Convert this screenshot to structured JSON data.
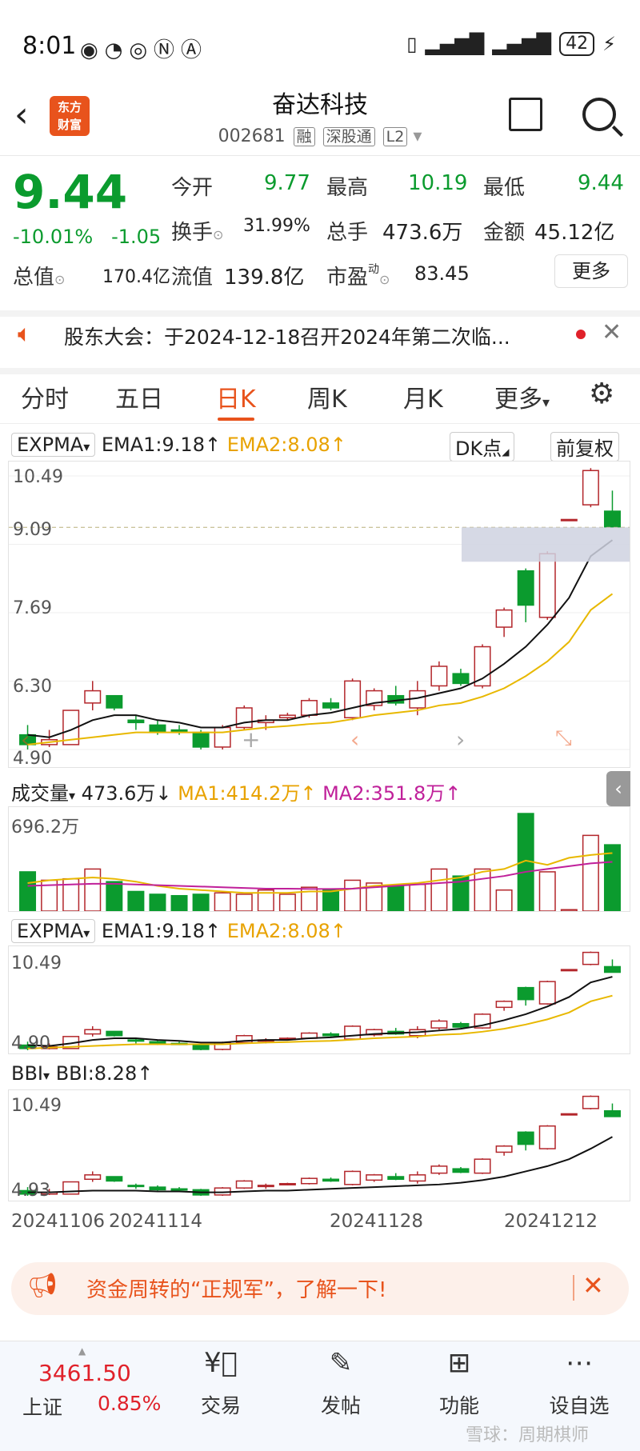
{
  "status_bar": {
    "time": "8:01",
    "battery": "42"
  },
  "header": {
    "title": "奋达科技",
    "code": "002681",
    "tags": [
      "融",
      "深股通",
      "L2"
    ]
  },
  "quote": {
    "price": "9.44",
    "pct": "-10.01%",
    "change": "-1.05",
    "fields": [
      {
        "label": "今开",
        "value": "9.77"
      },
      {
        "label": "最高",
        "value": "10.19"
      },
      {
        "label": "最低",
        "value": "9.44"
      },
      {
        "label": "换手",
        "value": "31.99%"
      },
      {
        "label": "总手",
        "value": "473.6万"
      },
      {
        "label": "金额",
        "value": "45.12亿"
      },
      {
        "label": "总值",
        "value": "170.4亿"
      },
      {
        "label": "流值",
        "value": "139.8亿"
      },
      {
        "label": "市盈",
        "value": "83.45"
      }
    ],
    "more_label": "更多"
  },
  "notice": {
    "text": "股东大会：于2024-12-18召开2024年第二次临..."
  },
  "tabs": [
    "分时",
    "五日",
    "日K",
    "周K",
    "月K",
    "更多"
  ],
  "active_tab": "日K",
  "main_chart": {
    "indicator": "EXPMA",
    "ema1": "EMA1:9.18",
    "ema2": "EMA2:8.08",
    "dk_label": "DK点",
    "adjust_label": "前复权",
    "y_labels": [
      "10.49",
      "9.09",
      "7.69",
      "6.30",
      "4.90"
    ]
  },
  "volume_chart": {
    "indicator": "成交量",
    "value": "473.6万",
    "ma1": "MA1:414.2万",
    "ma2": "MA2:351.8万",
    "y_label": "696.2万"
  },
  "expma_chart": {
    "indicator": "EXPMA",
    "ema1": "EMA1:9.18",
    "ema2": "EMA2:8.08",
    "y_top": "10.49",
    "y_bottom": "4.90"
  },
  "bbi_chart": {
    "indicator": "BBI",
    "value": "BBI:8.28",
    "y_top": "10.49",
    "y_bottom": "4.93"
  },
  "x_dates": [
    "20241106",
    "20241114",
    "20241128",
    "20241212"
  ],
  "chart_data": {
    "type": "candlestick",
    "candles": [
      {
        "o": 5.2,
        "c": 5.0,
        "h": 5.4,
        "l": 4.9
      },
      {
        "o": 5.0,
        "c": 5.1,
        "h": 5.3,
        "l": 4.95
      },
      {
        "o": 5.0,
        "c": 5.7,
        "h": 5.7,
        "l": 5.0
      },
      {
        "o": 5.85,
        "c": 6.1,
        "h": 6.3,
        "l": 5.7
      },
      {
        "o": 6.0,
        "c": 5.75,
        "h": 6.0,
        "l": 5.7
      },
      {
        "o": 5.5,
        "c": 5.45,
        "h": 5.6,
        "l": 5.3
      },
      {
        "o": 5.4,
        "c": 5.25,
        "h": 5.5,
        "l": 5.2
      },
      {
        "o": 5.3,
        "c": 5.25,
        "h": 5.4,
        "l": 5.2
      },
      {
        "o": 5.25,
        "c": 4.95,
        "h": 5.3,
        "l": 4.9
      },
      {
        "o": 4.95,
        "c": 5.35,
        "h": 5.4,
        "l": 4.9
      },
      {
        "o": 5.35,
        "c": 5.75,
        "h": 5.8,
        "l": 5.3
      },
      {
        "o": 5.45,
        "c": 5.5,
        "h": 5.6,
        "l": 5.3
      },
      {
        "o": 5.55,
        "c": 5.6,
        "h": 5.65,
        "l": 5.5
      },
      {
        "o": 5.6,
        "c": 5.9,
        "h": 5.95,
        "l": 5.55
      },
      {
        "o": 5.85,
        "c": 5.75,
        "h": 5.95,
        "l": 5.7
      },
      {
        "o": 5.55,
        "c": 6.3,
        "h": 6.35,
        "l": 5.5
      },
      {
        "o": 5.8,
        "c": 6.1,
        "h": 6.15,
        "l": 5.7
      },
      {
        "o": 6.0,
        "c": 5.85,
        "h": 6.2,
        "l": 5.8
      },
      {
        "o": 5.75,
        "c": 6.1,
        "h": 6.3,
        "l": 5.6
      },
      {
        "o": 6.2,
        "c": 6.6,
        "h": 6.7,
        "l": 6.1
      },
      {
        "o": 6.45,
        "c": 6.25,
        "h": 6.55,
        "l": 6.2
      },
      {
        "o": 6.2,
        "c": 7.0,
        "h": 7.05,
        "l": 6.15
      },
      {
        "o": 7.4,
        "c": 7.75,
        "h": 7.8,
        "l": 7.2
      },
      {
        "o": 8.55,
        "c": 7.85,
        "h": 8.6,
        "l": 7.5
      },
      {
        "o": 7.6,
        "c": 8.9,
        "h": 8.95,
        "l": 7.55
      },
      {
        "o": 9.6,
        "c": 9.6,
        "h": 9.6,
        "l": 9.6
      },
      {
        "o": 9.9,
        "c": 10.6,
        "h": 10.65,
        "l": 9.85
      },
      {
        "o": 9.77,
        "c": 9.44,
        "h": 10.19,
        "l": 9.44
      }
    ],
    "ema1": [
      5.2,
      5.15,
      5.3,
      5.5,
      5.6,
      5.6,
      5.5,
      5.45,
      5.35,
      5.35,
      5.45,
      5.5,
      5.5,
      5.6,
      5.65,
      5.75,
      5.85,
      5.9,
      5.95,
      6.05,
      6.15,
      6.35,
      6.65,
      7.0,
      7.45,
      8.0,
      8.85,
      9.18
    ],
    "ema2": [
      5.0,
      5.05,
      5.1,
      5.15,
      5.2,
      5.25,
      5.25,
      5.25,
      5.25,
      5.25,
      5.3,
      5.35,
      5.38,
      5.42,
      5.45,
      5.52,
      5.6,
      5.65,
      5.7,
      5.8,
      5.85,
      5.98,
      6.15,
      6.4,
      6.7,
      7.1,
      7.75,
      8.08
    ],
    "volume": [
      280,
      220,
      230,
      300,
      210,
      140,
      120,
      110,
      120,
      130,
      120,
      150,
      120,
      170,
      150,
      220,
      200,
      180,
      190,
      300,
      250,
      300,
      150,
      696,
      280,
      10,
      540,
      473
    ],
    "vol_ma1": [
      200,
      220,
      230,
      240,
      230,
      210,
      180,
      160,
      150,
      140,
      130,
      130,
      130,
      140,
      140,
      160,
      180,
      190,
      200,
      220,
      240,
      280,
      300,
      360,
      330,
      380,
      400,
      414
    ],
    "vol_ma2": [
      180,
      185,
      190,
      195,
      195,
      190,
      185,
      180,
      175,
      170,
      165,
      160,
      160,
      158,
      158,
      160,
      170,
      180,
      190,
      200,
      210,
      230,
      250,
      280,
      300,
      320,
      340,
      351
    ],
    "bbi": [
      5.1,
      5.1,
      5.15,
      5.2,
      5.2,
      5.2,
      5.15,
      5.15,
      5.1,
      5.1,
      5.15,
      5.2,
      5.2,
      5.25,
      5.3,
      5.35,
      5.4,
      5.45,
      5.5,
      5.55,
      5.65,
      5.8,
      6.0,
      6.3,
      6.6,
      7.0,
      7.6,
      8.28
    ],
    "ylim": [
      4.9,
      10.49
    ],
    "vol_max": 696.2
  },
  "banner": {
    "text": "资金周转的“正规军”，了解一下!"
  },
  "bottom_bar": {
    "index_value": "3461.50",
    "index_name": "上证",
    "index_pct": "0.85%",
    "items": [
      "交易",
      "发帖",
      "功能",
      "设自选"
    ]
  },
  "watermark": "雪球：周期棋师",
  "colors": {
    "up": "#b3262b",
    "down": "#0b9b2e",
    "ema1": "#111111",
    "ema2": "#e8b800",
    "ma2": "#c0209a",
    "accent": "#e8531c"
  }
}
